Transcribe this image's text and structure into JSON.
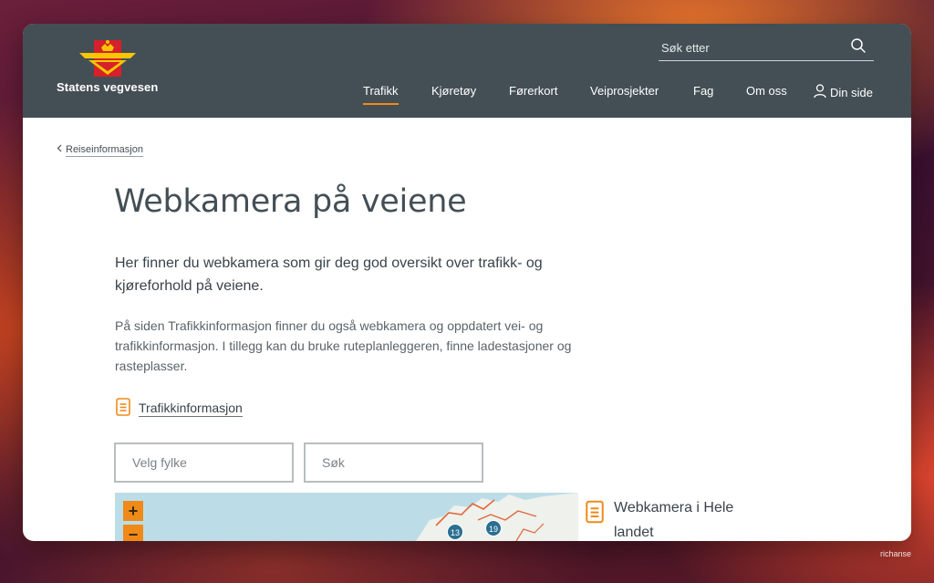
{
  "header": {
    "brand": "Statens vegvesen",
    "search": {
      "placeholder": "Søk etter"
    },
    "nav": [
      {
        "label": "Trafikk",
        "active": true
      },
      {
        "label": "Kjøretøy"
      },
      {
        "label": "Førerkort"
      },
      {
        "label": "Veiprosjekter"
      },
      {
        "label": "Fag"
      },
      {
        "label": "Om oss"
      },
      {
        "label": "Din side"
      }
    ]
  },
  "breadcrumb": {
    "label": "Reiseinformasjon"
  },
  "main": {
    "title": "Webkamera på veiene",
    "lead": "Her finner du webkamera som gir deg god oversikt over trafikk- og kjøreforhold på veiene.",
    "body": "På siden Trafikkinformasjon finner du også webkamera og oppdatert vei- og trafikkinformasjon. I tillegg kan du bruke ruteplanleggeren, finne ladestasjoner og rasteplasser.",
    "link": "Trafikkinformasjon",
    "filters": {
      "county_placeholder": "Velg fylke",
      "search_placeholder": "Søk"
    },
    "map": {
      "zoom_in": "+",
      "zoom_out": "−",
      "clusters": [
        "13",
        "19"
      ]
    },
    "side_link": {
      "line1": "Webkamera i Hele",
      "line2": "landet"
    }
  },
  "colors": {
    "header_bg": "#444f55",
    "accent": "#ef8a19",
    "map_water": "#bcdde8",
    "cluster": "#2a6f91"
  },
  "watermark": "richanse"
}
